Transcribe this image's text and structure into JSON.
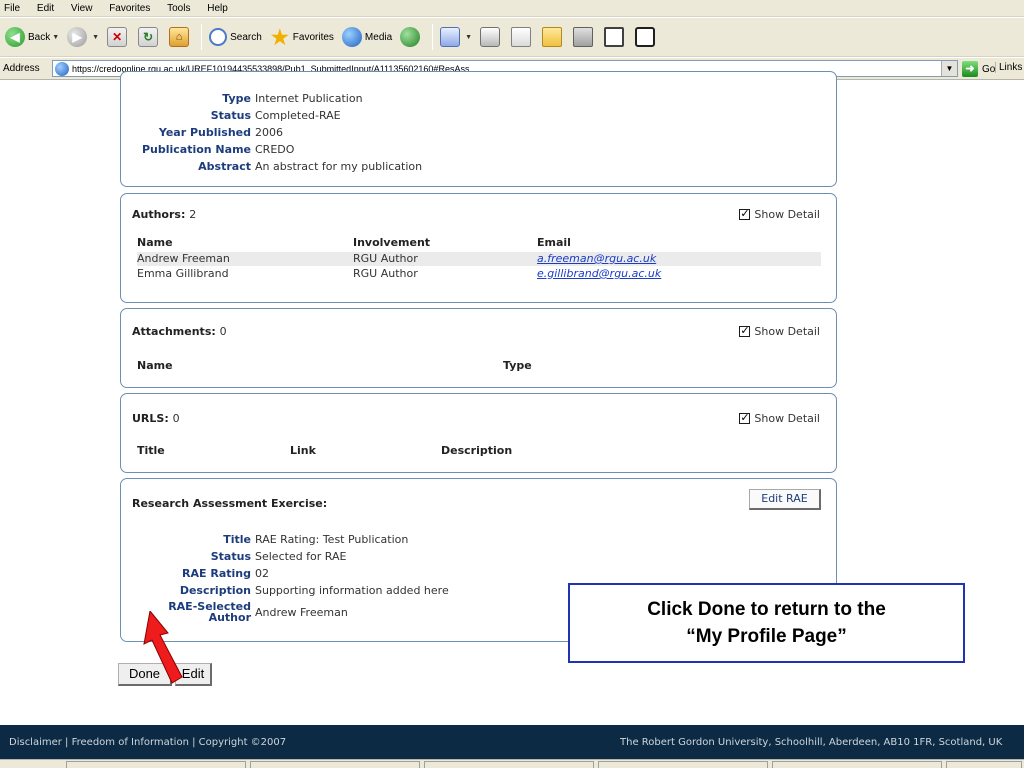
{
  "menu": [
    "File",
    "Edit",
    "View",
    "Favorites",
    "Tools",
    "Help"
  ],
  "toolbar": {
    "back": "Back",
    "search": "Search",
    "favorites": "Favorites",
    "media": "Media"
  },
  "address": {
    "label": "Address",
    "url": "https://credoonline.rgu.ac.uk/UREF10194435533898/Pub1_SubmittedInput/A11135602160#ResAss",
    "go": "Go",
    "links": "Links"
  },
  "publication": {
    "rows": [
      {
        "key": "Type",
        "value": "Internet Publication"
      },
      {
        "key": "Status",
        "value": "Completed-RAE"
      },
      {
        "key": "Year Published",
        "value": "2006"
      },
      {
        "key": "Publication Name",
        "value": "CREDO"
      },
      {
        "key": "Abstract",
        "value": "An abstract for my publication"
      }
    ]
  },
  "authors": {
    "title": "Authors:",
    "count": "2",
    "show_detail": "Show Detail",
    "headers": [
      "Name",
      "Involvement",
      "Email"
    ],
    "rows": [
      {
        "name": "Andrew Freeman",
        "involvement": "RGU Author",
        "email": "a.freeman@rgu.ac.uk"
      },
      {
        "name": "Emma Gillibrand",
        "involvement": "RGU Author",
        "email": "e.gillibrand@rgu.ac.uk"
      }
    ]
  },
  "attachments": {
    "title": "Attachments:",
    "count": "0",
    "show_detail": "Show Detail",
    "headers": [
      "Name",
      "Type"
    ]
  },
  "urls": {
    "title": "URLS:",
    "count": "0",
    "show_detail": "Show Detail",
    "headers": [
      "Title",
      "Link",
      "Description"
    ]
  },
  "rae": {
    "title": "Research Assessment Exercise:",
    "edit_label": "Edit RAE",
    "rows": [
      {
        "key": "Title",
        "value": "RAE Rating: Test Publication"
      },
      {
        "key": "Status",
        "value": "Selected for RAE"
      },
      {
        "key": "RAE Rating",
        "value": "02"
      },
      {
        "key": "Description",
        "value": "Supporting information added here"
      }
    ],
    "selected_author_key_1": "RAE-Selected",
    "selected_author_key_2": "Author",
    "selected_author_value": "Andrew Freeman"
  },
  "buttons": {
    "done": "Done",
    "edit": "Edit"
  },
  "callout": {
    "line1": "Click Done to return to the",
    "line2": "“My Profile Page”"
  },
  "footer": {
    "left": "Disclaimer | Freedom of Information | Copyright ©2007",
    "right": "The Robert Gordon University, Schoolhill, Aberdeen, AB10 1FR, Scotland, UK"
  }
}
